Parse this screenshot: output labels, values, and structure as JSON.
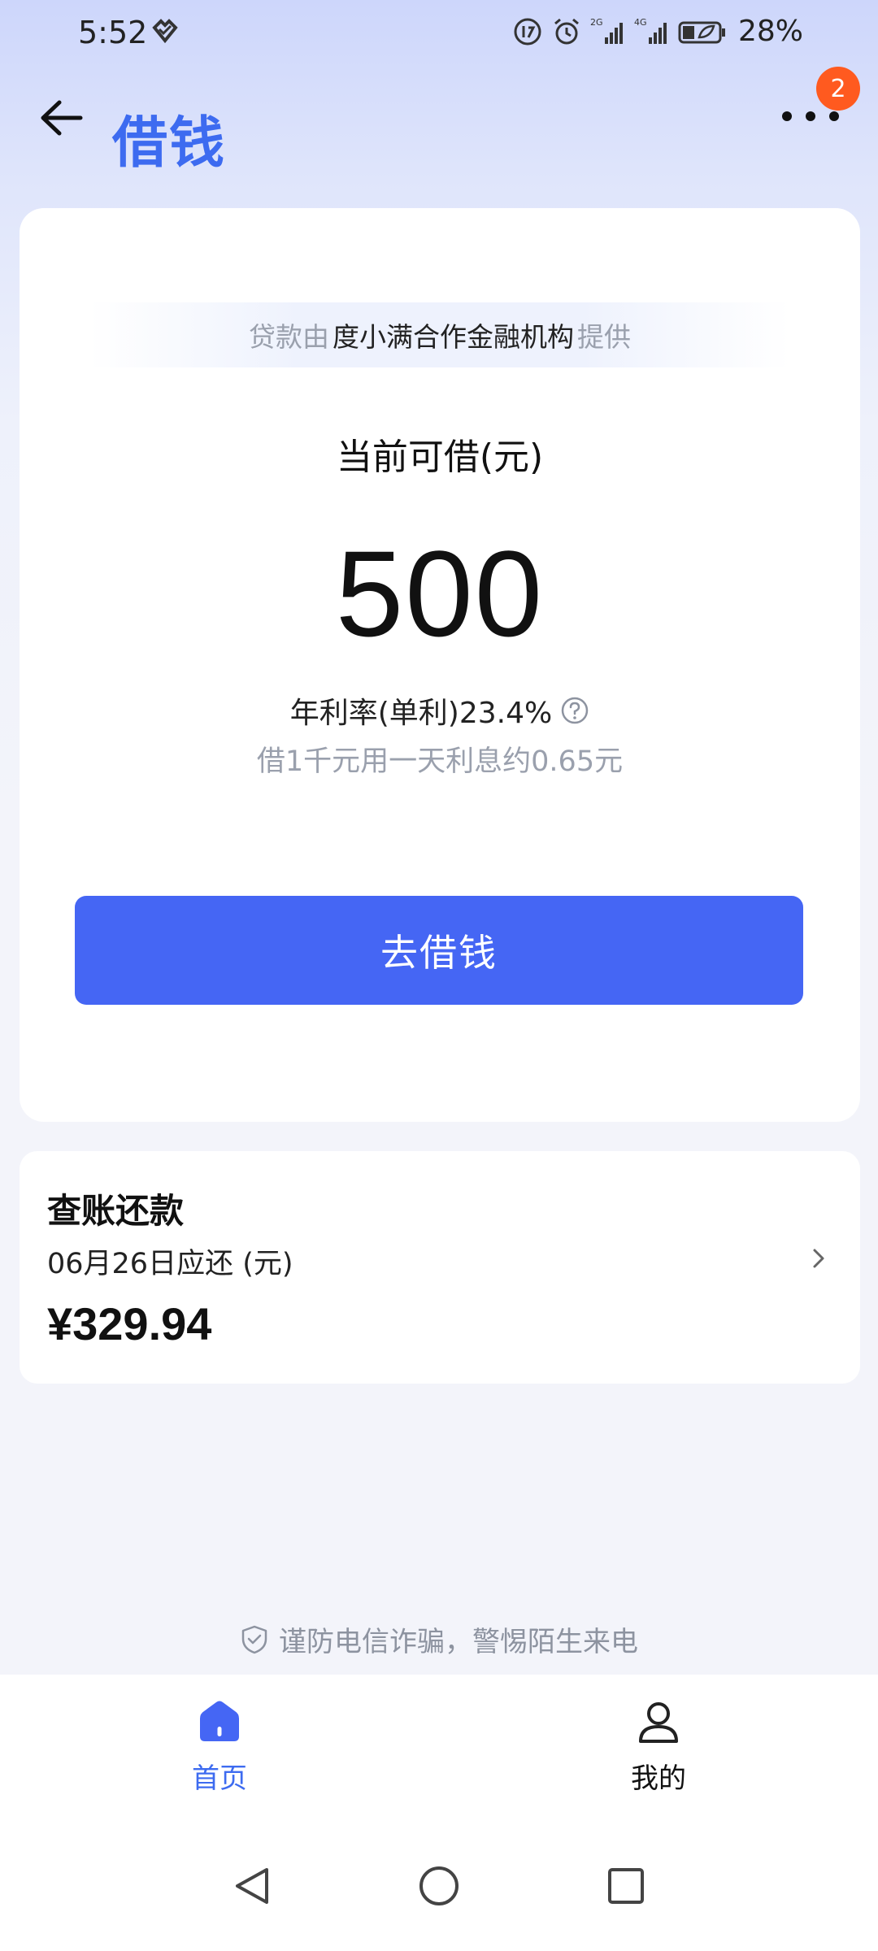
{
  "status_bar": {
    "time": "5:52",
    "network_1": "2G",
    "network_2": "4G",
    "battery": "28%"
  },
  "header": {
    "title": "借钱",
    "badge_count": "2"
  },
  "loan_card": {
    "provider_prefix": "贷款由",
    "provider_name": "度小满合作金融机构",
    "provider_suffix": "提供",
    "available_label": "当前可借(元)",
    "available_amount": "500",
    "annual_rate": "年利率(单利)23.4%",
    "interest_note": "借1千元用一天利息约0.65元",
    "borrow_button": "去借钱"
  },
  "repay_card": {
    "title": "查账还款",
    "due_label": "06月26日应还 (元)",
    "due_amount": "¥329.94"
  },
  "fraud_notice": "谨防电信诈骗，警惕陌生来电",
  "tabs": [
    {
      "label": "首页",
      "icon": "home-icon",
      "active": true
    },
    {
      "label": "我的",
      "icon": "user-icon",
      "active": false
    }
  ],
  "colors": {
    "accent": "#4566f4",
    "title": "#3d6bf0",
    "badge": "#ff5a1f"
  }
}
